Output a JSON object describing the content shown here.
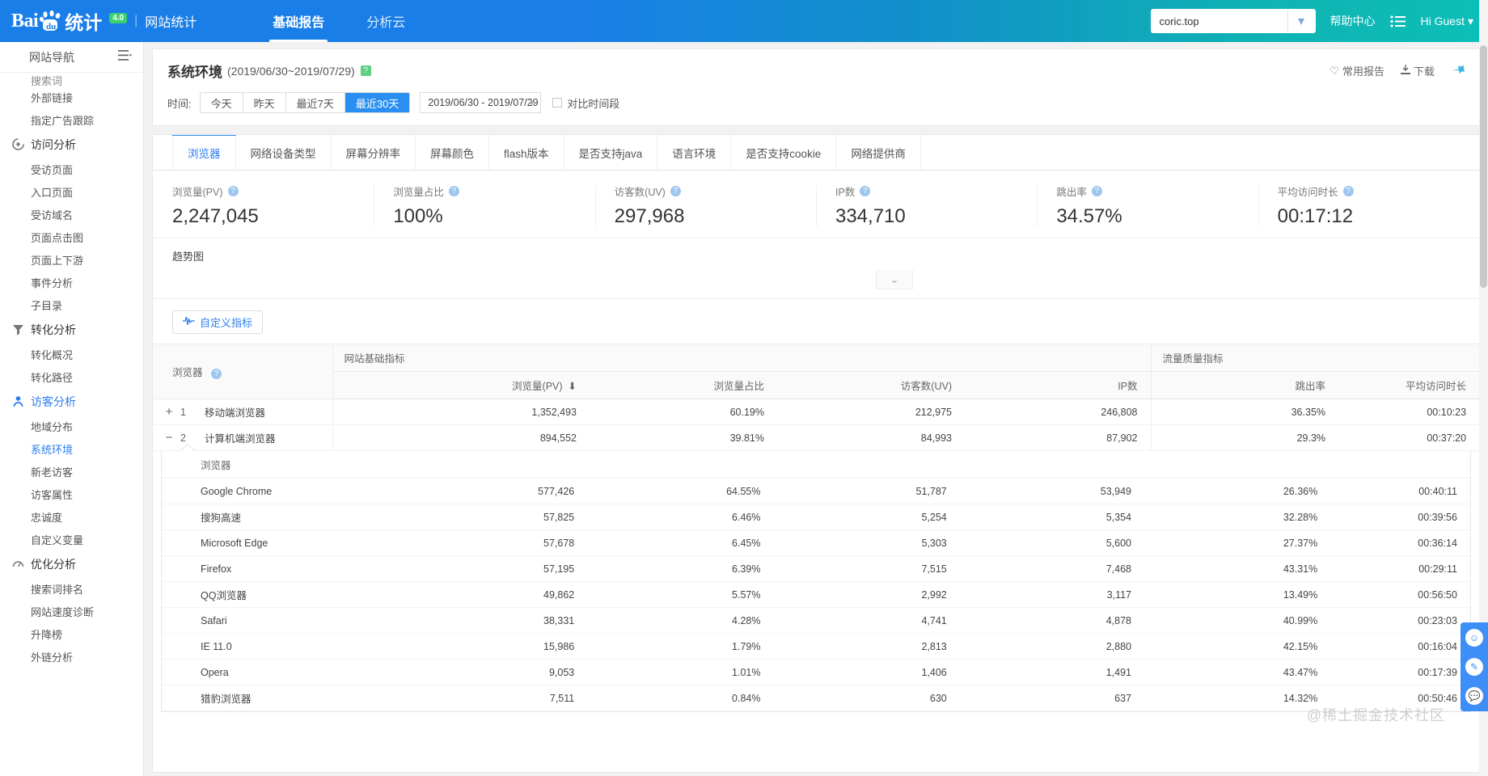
{
  "header": {
    "logo_main": "Bai",
    "logo_paw_alt": "baidu-paw-icon",
    "logo_tongji": "统计",
    "badge": "4.0",
    "separator": "|",
    "subtitle": "网站统计",
    "nav": [
      {
        "label": "基础报告",
        "active": true
      },
      {
        "label": "分析云",
        "active": false
      }
    ],
    "site_select_value": "coric.top",
    "help_label": "帮助中心",
    "user_label": "Hi Guest",
    "accent_blue": "#1a7ee8",
    "accent_teal": "#0cbfb8"
  },
  "sidebar": {
    "nav_header": "网站导航",
    "groups": [
      {
        "type": "item",
        "label": "搜索词",
        "clipped": true,
        "active": false
      },
      {
        "type": "item",
        "label": "外部链接",
        "active": false
      },
      {
        "type": "item",
        "label": "指定广告跟踪",
        "active": false
      },
      {
        "type": "group",
        "label": "访问分析",
        "icon": "visit-analysis-icon",
        "active": false
      },
      {
        "type": "item",
        "label": "受访页面",
        "active": false
      },
      {
        "type": "item",
        "label": "入口页面",
        "active": false
      },
      {
        "type": "item",
        "label": "受访域名",
        "active": false
      },
      {
        "type": "item",
        "label": "页面点击图",
        "active": false
      },
      {
        "type": "item",
        "label": "页面上下游",
        "active": false
      },
      {
        "type": "item",
        "label": "事件分析",
        "active": false
      },
      {
        "type": "item",
        "label": "子目录",
        "active": false
      },
      {
        "type": "group",
        "label": "转化分析",
        "icon": "funnel-icon",
        "active": false
      },
      {
        "type": "item",
        "label": "转化概况",
        "active": false
      },
      {
        "type": "item",
        "label": "转化路径",
        "active": false
      },
      {
        "type": "group",
        "label": "访客分析",
        "icon": "visitor-icon",
        "active": true
      },
      {
        "type": "item",
        "label": "地域分布",
        "active": false
      },
      {
        "type": "item",
        "label": "系统环境",
        "active": true
      },
      {
        "type": "item",
        "label": "新老访客",
        "active": false
      },
      {
        "type": "item",
        "label": "访客属性",
        "active": false
      },
      {
        "type": "item",
        "label": "忠诚度",
        "active": false
      },
      {
        "type": "item",
        "label": "自定义变量",
        "active": false
      },
      {
        "type": "group",
        "label": "优化分析",
        "icon": "gauge-icon",
        "active": false
      },
      {
        "type": "item",
        "label": "搜索词排名",
        "active": false
      },
      {
        "type": "item",
        "label": "网站速度诊断",
        "active": false
      },
      {
        "type": "item",
        "label": "升降榜",
        "active": false
      },
      {
        "type": "item",
        "label": "外链分析",
        "active": false
      }
    ]
  },
  "page": {
    "title": "系统环境",
    "date_range_title": "(2019/06/30~2019/07/29)",
    "actions": {
      "favorite_label": "常用报告",
      "download_label": "下载",
      "pin_label": "pin-icon"
    },
    "time_label": "时间:",
    "segments": [
      {
        "label": "今天",
        "active": false
      },
      {
        "label": "昨天",
        "active": false
      },
      {
        "label": "最近7天",
        "active": false
      },
      {
        "label": "最近30天",
        "active": true
      }
    ],
    "date_picker_value": "2019/06/30 - 2019/07/29",
    "compare_label": "对比时间段",
    "compare_checked": false
  },
  "tabs": [
    {
      "label": "浏览器",
      "active": true
    },
    {
      "label": "网络设备类型",
      "active": false
    },
    {
      "label": "屏幕分辨率",
      "active": false
    },
    {
      "label": "屏幕颜色",
      "active": false
    },
    {
      "label": "flash版本",
      "active": false
    },
    {
      "label": "是否支持java",
      "active": false
    },
    {
      "label": "语言环境",
      "active": false
    },
    {
      "label": "是否支持cookie",
      "active": false
    },
    {
      "label": "网络提供商",
      "active": false
    }
  ],
  "kpis": [
    {
      "label": "浏览量(PV)",
      "value": "2,247,045"
    },
    {
      "label": "浏览量占比",
      "value": "100%"
    },
    {
      "label": "访客数(UV)",
      "value": "297,968"
    },
    {
      "label": "IP数",
      "value": "334,710"
    },
    {
      "label": "跳出率",
      "value": "34.57%"
    },
    {
      "label": "平均访问时长",
      "value": "00:17:12"
    }
  ],
  "trend": {
    "title": "趋势图",
    "collapse_icon": "chevron-double-down-icon",
    "custom_metric_label": "自定义指标",
    "custom_metric_icon": "pulse-icon"
  },
  "table": {
    "dimension_header": "浏览器",
    "group_headers": [
      {
        "label": "网站基础指标"
      },
      {
        "label": "流量质量指标"
      }
    ],
    "columns": [
      {
        "label": "浏览量(PV)",
        "sorted": true,
        "sort_icon": "arrow-down-icon"
      },
      {
        "label": "浏览量占比",
        "sorted": false
      },
      {
        "label": "访客数(UV)",
        "sorted": false
      },
      {
        "label": "IP数",
        "sorted": false
      },
      {
        "label": "跳出率",
        "sorted": false
      },
      {
        "label": "平均访问时长",
        "sorted": false
      }
    ],
    "rows": [
      {
        "sign": "+",
        "index": "1",
        "name": "移动端浏览器",
        "pv": "1,352,493",
        "pv_pct": "60.19%",
        "uv": "212,975",
        "ip": "246,808",
        "bounce": "36.35%",
        "avg_time": "00:10:23",
        "expanded": false
      },
      {
        "sign": "−",
        "index": "2",
        "name": "计算机端浏览器",
        "pv": "894,552",
        "pv_pct": "39.81%",
        "uv": "84,993",
        "ip": "87,902",
        "bounce": "29.3%",
        "avg_time": "00:37:20",
        "expanded": true
      }
    ],
    "nested": {
      "header": "浏览器",
      "rows": [
        {
          "name": "Google Chrome",
          "pv": "577,426",
          "pv_pct": "64.55%",
          "uv": "51,787",
          "ip": "53,949",
          "bounce": "26.36%",
          "avg_time": "00:40:11"
        },
        {
          "name": "搜狗高速",
          "pv": "57,825",
          "pv_pct": "6.46%",
          "uv": "5,254",
          "ip": "5,354",
          "bounce": "32.28%",
          "avg_time": "00:39:56"
        },
        {
          "name": "Microsoft Edge",
          "pv": "57,678",
          "pv_pct": "6.45%",
          "uv": "5,303",
          "ip": "5,600",
          "bounce": "27.37%",
          "avg_time": "00:36:14"
        },
        {
          "name": "Firefox",
          "pv": "57,195",
          "pv_pct": "6.39%",
          "uv": "7,515",
          "ip": "7,468",
          "bounce": "43.31%",
          "avg_time": "00:29:11"
        },
        {
          "name": "QQ浏览器",
          "pv": "49,862",
          "pv_pct": "5.57%",
          "uv": "2,992",
          "ip": "3,117",
          "bounce": "13.49%",
          "avg_time": "00:56:50"
        },
        {
          "name": "Safari",
          "pv": "38,331",
          "pv_pct": "4.28%",
          "uv": "4,741",
          "ip": "4,878",
          "bounce": "40.99%",
          "avg_time": "00:23:03"
        },
        {
          "name": "IE 11.0",
          "pv": "15,986",
          "pv_pct": "1.79%",
          "uv": "2,813",
          "ip": "2,880",
          "bounce": "42.15%",
          "avg_time": "00:16:04"
        },
        {
          "name": "Opera",
          "pv": "9,053",
          "pv_pct": "1.01%",
          "uv": "1,406",
          "ip": "1,491",
          "bounce": "43.47%",
          "avg_time": "00:17:39"
        },
        {
          "name": "猎豹浏览器",
          "pv": "7,511",
          "pv_pct": "0.84%",
          "uv": "630",
          "ip": "637",
          "bounce": "14.32%",
          "avg_time": "00:50:46"
        }
      ]
    }
  },
  "float_widget": {
    "buttons": [
      "smiley-icon",
      "pencil-icon",
      "chat-icon"
    ]
  },
  "watermark": "@稀土掘金技术社区"
}
